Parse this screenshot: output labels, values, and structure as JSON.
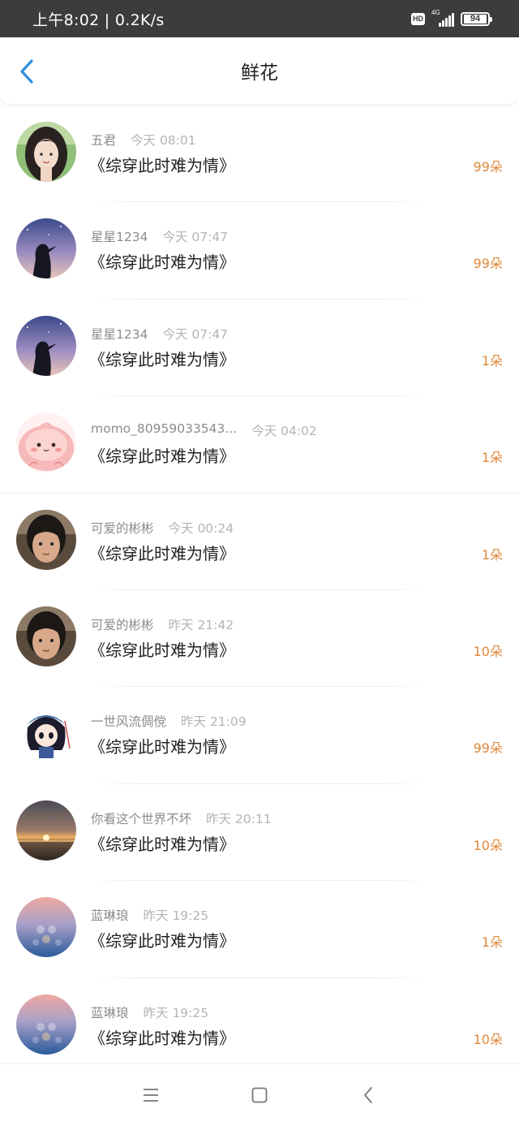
{
  "status_bar": {
    "time_speed": "上午8:02 | 0.2K/s",
    "hd": "HD",
    "network": "4G",
    "battery": "94"
  },
  "header": {
    "title": "鲜花"
  },
  "items": [
    {
      "name": "五君",
      "time": "今天 08:01",
      "book": "《综穿此时难为情》",
      "count": "99朵",
      "avatar": "woman-portrait"
    },
    {
      "name": "星星1234",
      "time": "今天 07:47",
      "book": "《综穿此时难为情》",
      "count": "99朵",
      "avatar": "silhouette-sky"
    },
    {
      "name": "星星1234",
      "time": "今天 07:47",
      "book": "《综穿此时难为情》",
      "count": "1朵",
      "avatar": "silhouette-sky"
    },
    {
      "name": "momo_80959033543...",
      "time": "今天 04:02",
      "book": "《综穿此时难为情》",
      "count": "1朵",
      "avatar": "pink-cartoon"
    },
    {
      "name": "可爱的彬彬",
      "time": "今天 00:24",
      "book": "《综穿此时难为情》",
      "count": "1朵",
      "avatar": "selfie"
    },
    {
      "name": "可爱的彬彬",
      "time": "昨天 21:42",
      "book": "《综穿此时难为情》",
      "count": "10朵",
      "avatar": "selfie"
    },
    {
      "name": "一世风流倜傥",
      "time": "昨天 21:09",
      "book": "《综穿此时难为情》",
      "count": "99朵",
      "avatar": "anime-character"
    },
    {
      "name": "你看这个世界不坏",
      "time": "昨天 20:11",
      "book": "《综穿此时难为情》",
      "count": "10朵",
      "avatar": "sunset"
    },
    {
      "name": "蓝琳琅",
      "time": "昨天 19:25",
      "book": "《综穿此时难为情》",
      "count": "1朵",
      "avatar": "bokeh"
    },
    {
      "name": "蓝琳琅",
      "time": "昨天 19:25",
      "book": "《综穿此时难为情》",
      "count": "10朵",
      "avatar": "bokeh"
    }
  ],
  "nav": {
    "menu_icon": "menu-icon",
    "home_icon": "home-icon",
    "back_icon": "back-icon"
  },
  "colors": {
    "accent": "#2f8fe0",
    "count": "#e0883a",
    "status_bar": "#3c3c3c"
  }
}
